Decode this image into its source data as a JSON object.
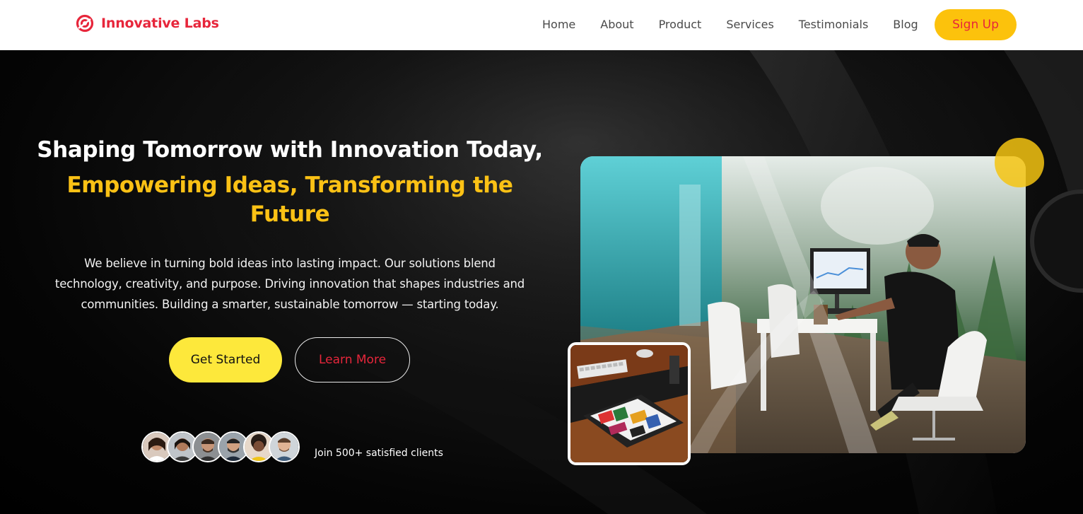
{
  "brand": {
    "name": "Innovative Labs",
    "logo_icon": "ring-logo-icon",
    "color": "#e7263b"
  },
  "nav": {
    "links": [
      "Home",
      "About",
      "Product",
      "Services",
      "Testimonials",
      "Blog"
    ],
    "signup_label": "Sign Up"
  },
  "hero": {
    "headline": "Shaping Tomorrow with Innovation Today,",
    "subheadline": "Empowering Ideas, Transforming the Future",
    "description": "We believe in turning bold ideas into lasting impact. Our solutions blend technology, creativity, and purpose. Driving innovation that shapes industries and communities. Building a smarter, sustainable tomorrow — starting today.",
    "primary_cta": "Get Started",
    "secondary_cta": "Learn More",
    "clients_text": "Join 500+ satisfied clients",
    "avatars": [
      "client-avatar",
      "client-avatar",
      "client-avatar",
      "client-avatar",
      "client-avatar",
      "client-avatar"
    ]
  },
  "colors": {
    "accent_yellow": "#fcc20c",
    "button_yellow": "#fde83b",
    "brand_red": "#e7263b",
    "background": "#000000"
  }
}
